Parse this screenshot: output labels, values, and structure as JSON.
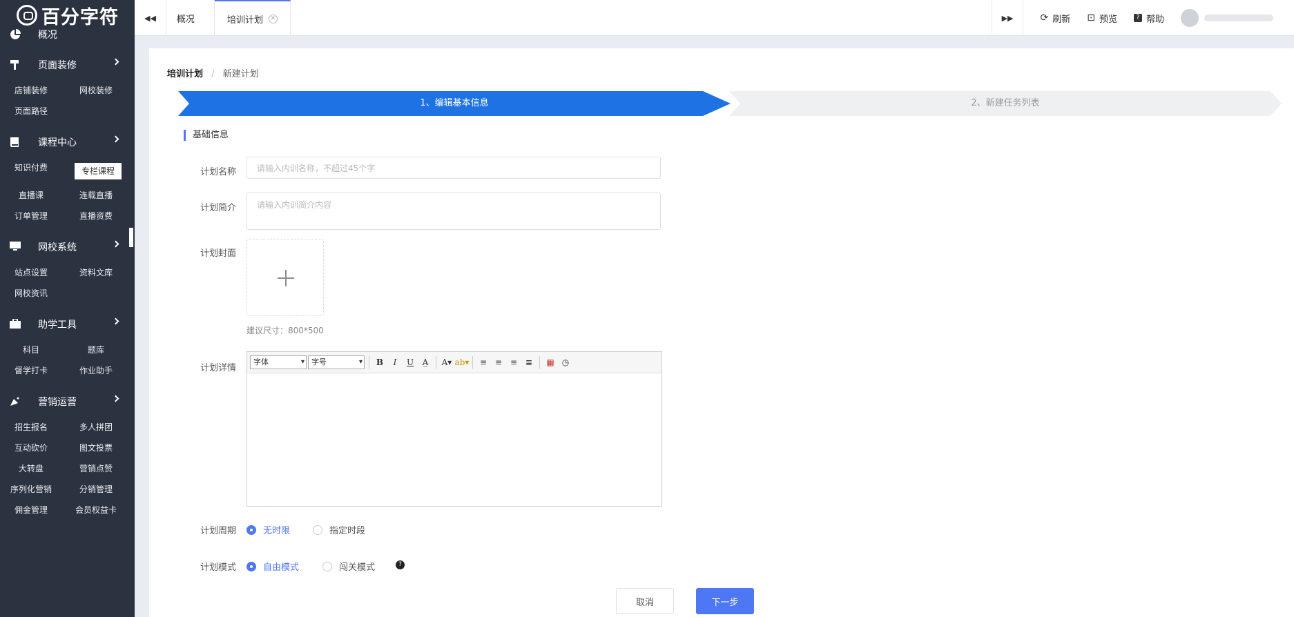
{
  "sidebar": {
    "logo": "百分字符",
    "overview": "概况",
    "decor": {
      "title": "页面装修",
      "items": [
        "店铺装修",
        "网校装修",
        "页面路径"
      ]
    },
    "course": {
      "title": "课程中心",
      "items": [
        "知识付费",
        "专栏课程",
        "直播课",
        "连载直播",
        "订单管理",
        "直播资费"
      ]
    },
    "school": {
      "title": "网校系统",
      "items": [
        "站点设置",
        "资料文库",
        "网校资讯"
      ]
    },
    "tools": {
      "title": "助学工具",
      "items": [
        "科目",
        "题库",
        "督学打卡",
        "作业助手"
      ]
    },
    "marketing": {
      "title": "营销运营",
      "items": [
        "招生报名",
        "多人拼团",
        "互动砍价",
        "图文投票",
        "大转盘",
        "营销点赞",
        "序列化营销",
        "分销管理",
        "佣金管理",
        "会员权益卡"
      ]
    }
  },
  "topbar": {
    "tabs": [
      "概况",
      "培训计划"
    ],
    "refresh": "刷新",
    "preview": "预览",
    "help": "帮助"
  },
  "breadcrumb": {
    "root": "培训计划",
    "sep": "/",
    "current": "新建计划"
  },
  "steps": [
    "1、编辑基本信息",
    "2、新建任务列表"
  ],
  "section_title": "基础信息",
  "form": {
    "name_label": "计划名称",
    "name_placeholder": "请输入内训名称，不超过45个字",
    "intro_label": "计划简介",
    "intro_placeholder": "请输入内训简介内容",
    "cover_label": "计划封面",
    "cover_hint": "建议尺寸：800*500",
    "detail_label": "计划详情",
    "font_select": "字体",
    "size_select": "字号",
    "period_label": "计划周期",
    "period_opt1": "无时限",
    "period_opt2": "指定时段",
    "mode_label": "计划模式",
    "mode_opt1": "自由模式",
    "mode_opt2": "闯关模式"
  },
  "buttons": {
    "cancel": "取消",
    "next": "下一步"
  },
  "colors": {
    "primary": "#4e77f4",
    "step_active": "#1e72e4",
    "sidebar": "#2b3240"
  }
}
